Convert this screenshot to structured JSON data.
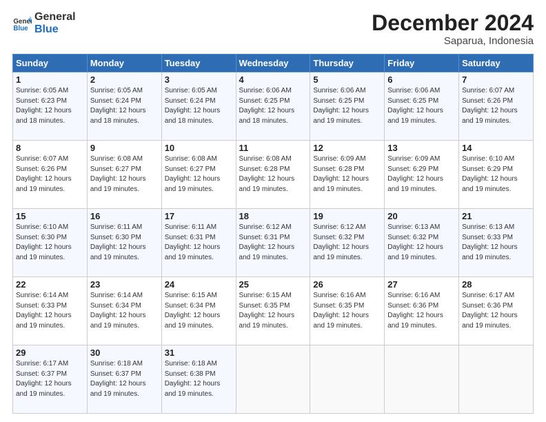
{
  "logo": {
    "line1": "General",
    "line2": "Blue"
  },
  "title": "December 2024",
  "subtitle": "Saparua, Indonesia",
  "days_header": [
    "Sunday",
    "Monday",
    "Tuesday",
    "Wednesday",
    "Thursday",
    "Friday",
    "Saturday"
  ],
  "weeks": [
    [
      {
        "day": "1",
        "info": "Sunrise: 6:05 AM\nSunset: 6:23 PM\nDaylight: 12 hours\nand 18 minutes."
      },
      {
        "day": "2",
        "info": "Sunrise: 6:05 AM\nSunset: 6:24 PM\nDaylight: 12 hours\nand 18 minutes."
      },
      {
        "day": "3",
        "info": "Sunrise: 6:05 AM\nSunset: 6:24 PM\nDaylight: 12 hours\nand 18 minutes."
      },
      {
        "day": "4",
        "info": "Sunrise: 6:06 AM\nSunset: 6:25 PM\nDaylight: 12 hours\nand 18 minutes."
      },
      {
        "day": "5",
        "info": "Sunrise: 6:06 AM\nSunset: 6:25 PM\nDaylight: 12 hours\nand 19 minutes."
      },
      {
        "day": "6",
        "info": "Sunrise: 6:06 AM\nSunset: 6:25 PM\nDaylight: 12 hours\nand 19 minutes."
      },
      {
        "day": "7",
        "info": "Sunrise: 6:07 AM\nSunset: 6:26 PM\nDaylight: 12 hours\nand 19 minutes."
      }
    ],
    [
      {
        "day": "8",
        "info": "Sunrise: 6:07 AM\nSunset: 6:26 PM\nDaylight: 12 hours\nand 19 minutes."
      },
      {
        "day": "9",
        "info": "Sunrise: 6:08 AM\nSunset: 6:27 PM\nDaylight: 12 hours\nand 19 minutes."
      },
      {
        "day": "10",
        "info": "Sunrise: 6:08 AM\nSunset: 6:27 PM\nDaylight: 12 hours\nand 19 minutes."
      },
      {
        "day": "11",
        "info": "Sunrise: 6:08 AM\nSunset: 6:28 PM\nDaylight: 12 hours\nand 19 minutes."
      },
      {
        "day": "12",
        "info": "Sunrise: 6:09 AM\nSunset: 6:28 PM\nDaylight: 12 hours\nand 19 minutes."
      },
      {
        "day": "13",
        "info": "Sunrise: 6:09 AM\nSunset: 6:29 PM\nDaylight: 12 hours\nand 19 minutes."
      },
      {
        "day": "14",
        "info": "Sunrise: 6:10 AM\nSunset: 6:29 PM\nDaylight: 12 hours\nand 19 minutes."
      }
    ],
    [
      {
        "day": "15",
        "info": "Sunrise: 6:10 AM\nSunset: 6:30 PM\nDaylight: 12 hours\nand 19 minutes."
      },
      {
        "day": "16",
        "info": "Sunrise: 6:11 AM\nSunset: 6:30 PM\nDaylight: 12 hours\nand 19 minutes."
      },
      {
        "day": "17",
        "info": "Sunrise: 6:11 AM\nSunset: 6:31 PM\nDaylight: 12 hours\nand 19 minutes."
      },
      {
        "day": "18",
        "info": "Sunrise: 6:12 AM\nSunset: 6:31 PM\nDaylight: 12 hours\nand 19 minutes."
      },
      {
        "day": "19",
        "info": "Sunrise: 6:12 AM\nSunset: 6:32 PM\nDaylight: 12 hours\nand 19 minutes."
      },
      {
        "day": "20",
        "info": "Sunrise: 6:13 AM\nSunset: 6:32 PM\nDaylight: 12 hours\nand 19 minutes."
      },
      {
        "day": "21",
        "info": "Sunrise: 6:13 AM\nSunset: 6:33 PM\nDaylight: 12 hours\nand 19 minutes."
      }
    ],
    [
      {
        "day": "22",
        "info": "Sunrise: 6:14 AM\nSunset: 6:33 PM\nDaylight: 12 hours\nand 19 minutes."
      },
      {
        "day": "23",
        "info": "Sunrise: 6:14 AM\nSunset: 6:34 PM\nDaylight: 12 hours\nand 19 minutes."
      },
      {
        "day": "24",
        "info": "Sunrise: 6:15 AM\nSunset: 6:34 PM\nDaylight: 12 hours\nand 19 minutes."
      },
      {
        "day": "25",
        "info": "Sunrise: 6:15 AM\nSunset: 6:35 PM\nDaylight: 12 hours\nand 19 minutes."
      },
      {
        "day": "26",
        "info": "Sunrise: 6:16 AM\nSunset: 6:35 PM\nDaylight: 12 hours\nand 19 minutes."
      },
      {
        "day": "27",
        "info": "Sunrise: 6:16 AM\nSunset: 6:36 PM\nDaylight: 12 hours\nand 19 minutes."
      },
      {
        "day": "28",
        "info": "Sunrise: 6:17 AM\nSunset: 6:36 PM\nDaylight: 12 hours\nand 19 minutes."
      }
    ],
    [
      {
        "day": "29",
        "info": "Sunrise: 6:17 AM\nSunset: 6:37 PM\nDaylight: 12 hours\nand 19 minutes."
      },
      {
        "day": "30",
        "info": "Sunrise: 6:18 AM\nSunset: 6:37 PM\nDaylight: 12 hours\nand 19 minutes."
      },
      {
        "day": "31",
        "info": "Sunrise: 6:18 AM\nSunset: 6:38 PM\nDaylight: 12 hours\nand 19 minutes."
      },
      {
        "day": "",
        "info": ""
      },
      {
        "day": "",
        "info": ""
      },
      {
        "day": "",
        "info": ""
      },
      {
        "day": "",
        "info": ""
      }
    ]
  ]
}
